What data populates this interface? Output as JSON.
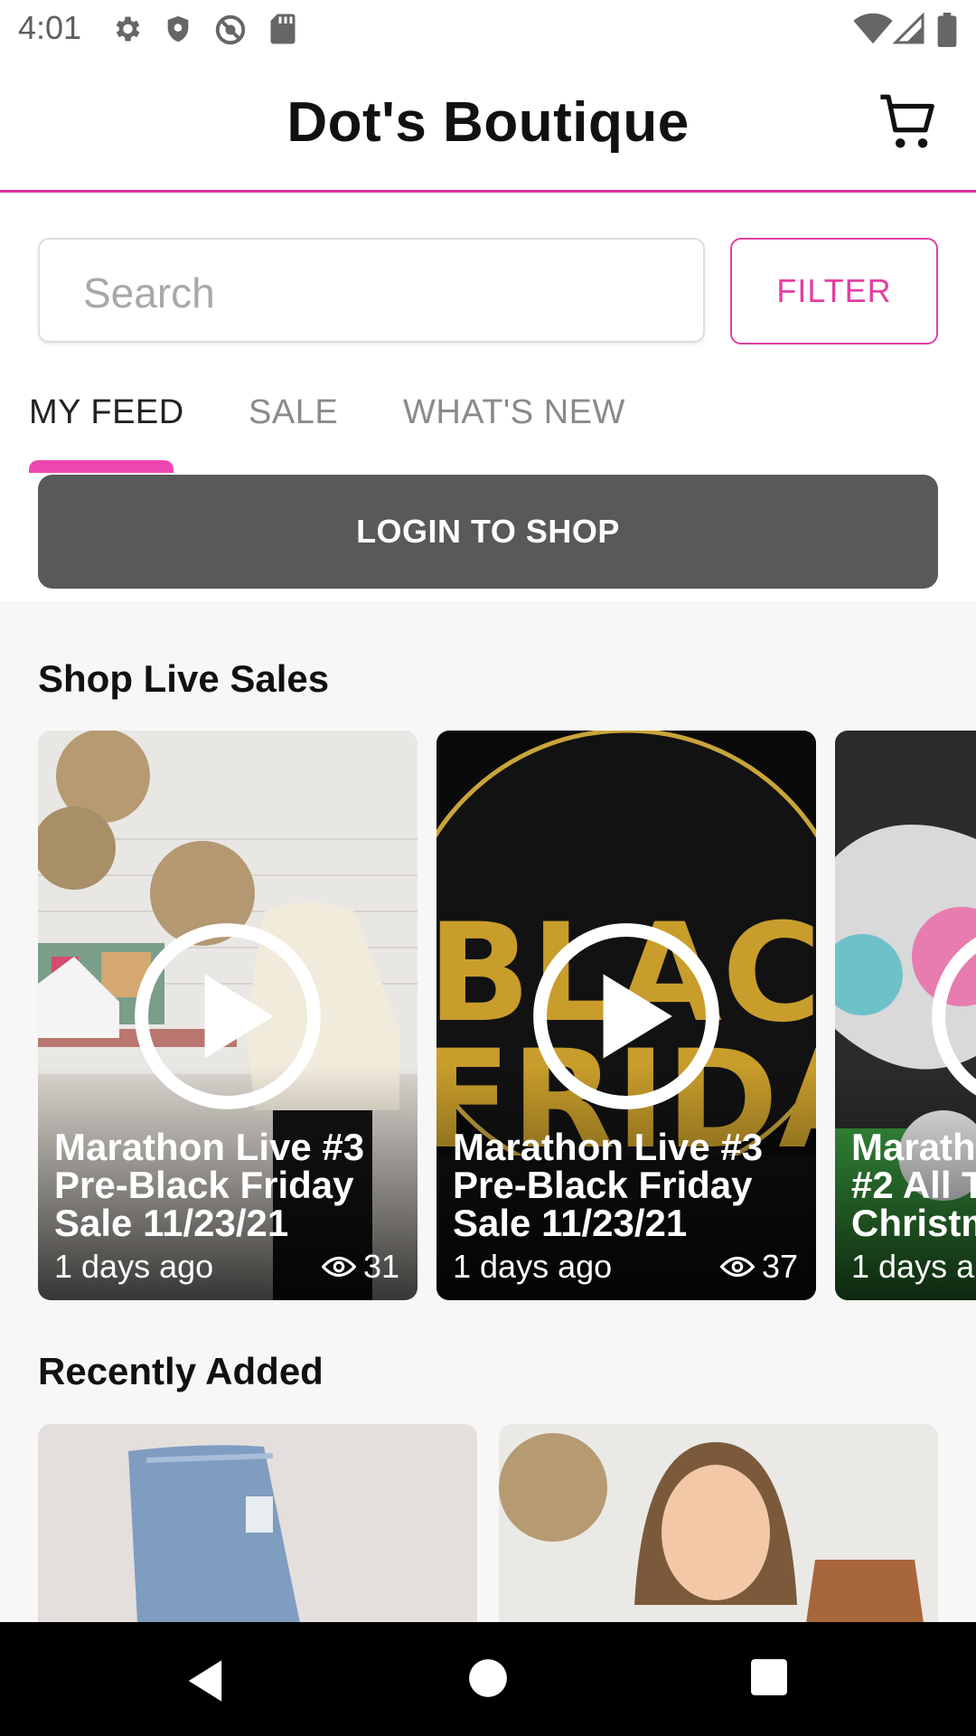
{
  "status_bar": {
    "time": "4:01",
    "icons": [
      "settings-icon",
      "shield-icon",
      "no-sync-icon",
      "sd-card-icon",
      "wifi-icon",
      "signal-icon",
      "battery-icon"
    ]
  },
  "header": {
    "title": "Dot's Boutique",
    "cart_icon": "cart-icon"
  },
  "search": {
    "placeholder": "Search",
    "value": ""
  },
  "filter_label": "FILTER",
  "tabs": [
    {
      "label": "MY FEED",
      "active": true
    },
    {
      "label": "SALE",
      "active": false
    },
    {
      "label": "WHAT'S NEW",
      "active": false
    }
  ],
  "login_label": "LOGIN TO SHOP",
  "live_sales": {
    "title": "Shop Live Sales",
    "cards": [
      {
        "title_lines": [
          "Marathon Live #3",
          "Pre-Black Friday",
          "Sale 11/23/21"
        ],
        "time": "1 days ago",
        "views": "31"
      },
      {
        "title_lines": [
          "Marathon Live #3",
          "Pre-Black Friday",
          "Sale 11/23/21"
        ],
        "time": "1 days ago",
        "views": "37"
      },
      {
        "title_lines": [
          "Marath",
          "#2 All T",
          "Christm"
        ],
        "time": "1 days a",
        "views": ""
      }
    ]
  },
  "recently_added": {
    "title": "Recently Added"
  },
  "colors": {
    "accent": "#e23ea3",
    "login_bg": "#595959"
  }
}
